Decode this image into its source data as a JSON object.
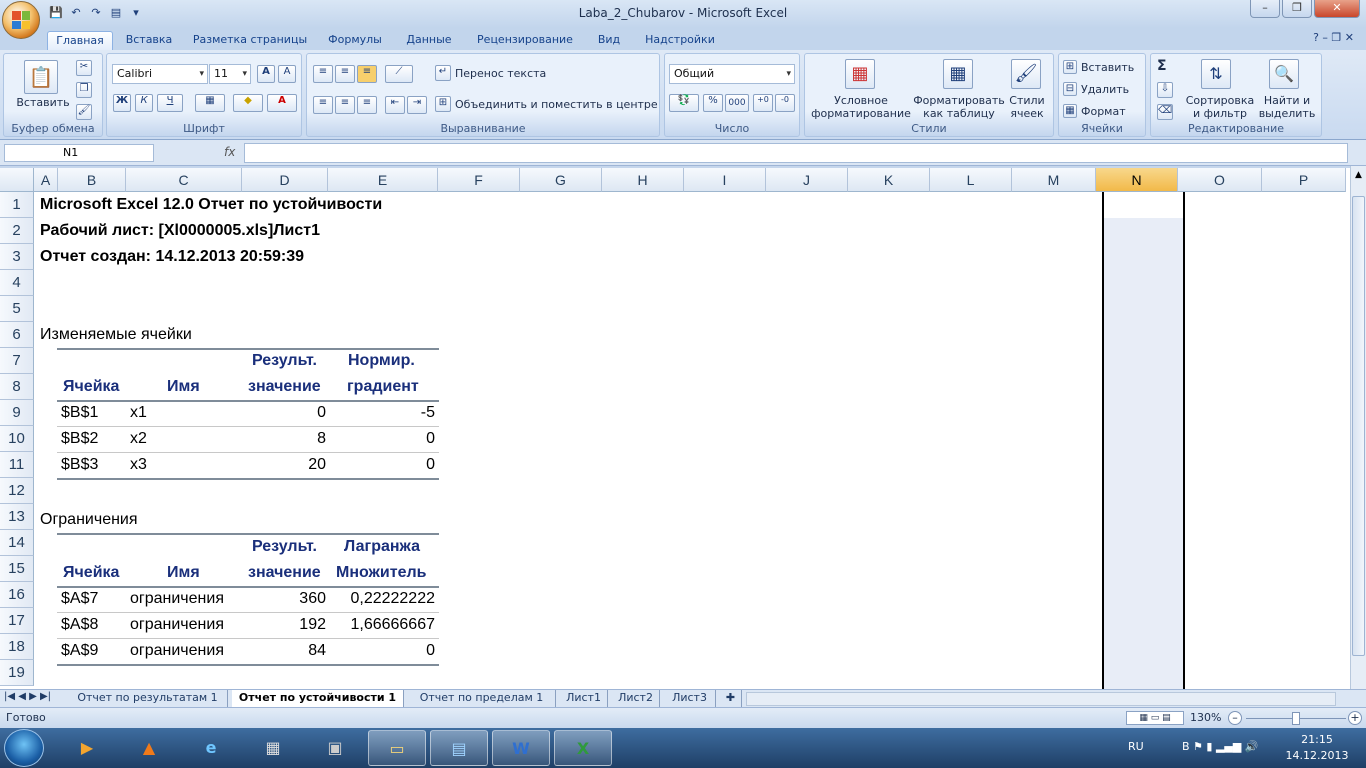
{
  "window": {
    "title": "Laba_2_Chubarov - Microsoft Excel",
    "min": "–",
    "max": "❐",
    "close": "✕"
  },
  "ribbon_tabs": [
    "Главная",
    "Вставка",
    "Разметка страницы",
    "Формулы",
    "Данные",
    "Рецензирование",
    "Вид",
    "Надстройки"
  ],
  "ribbon": {
    "clipboard": {
      "label": "Буфер обмена",
      "paste": "Вставить"
    },
    "font": {
      "label": "Шрифт",
      "name": "Calibri",
      "size": "11",
      "bold": "Ж",
      "italic": "К",
      "underline": "Ч"
    },
    "alignment": {
      "label": "Выравнивание",
      "wrap": "Перенос текста",
      "merge": "Объединить и поместить в центре"
    },
    "number": {
      "label": "Число",
      "format": "Общий",
      "percent": "%",
      "thousands": "000"
    },
    "styles": {
      "label": "Стили",
      "conditional": "Условное форматирование",
      "as_table": "Форматировать как таблицу",
      "cell_styles": "Стили ячеек"
    },
    "cells": {
      "label": "Ячейки",
      "insert": "Вставить",
      "delete": "Удалить",
      "format": "Формат"
    },
    "editing": {
      "label": "Редактирование",
      "sum": "Σ",
      "sort": "Сортировка и фильтр",
      "find": "Найти и выделить"
    }
  },
  "formula_bar": {
    "name_box": "N1",
    "fx": "fx",
    "value": ""
  },
  "columns": [
    "A",
    "B",
    "C",
    "D",
    "E",
    "F",
    "G",
    "H",
    "I",
    "J",
    "K",
    "L",
    "M",
    "N",
    "O",
    "P"
  ],
  "selected_column": "N",
  "rows": [
    "1",
    "2",
    "3",
    "4",
    "5",
    "6",
    "7",
    "8",
    "9",
    "10",
    "11",
    "12",
    "13",
    "14",
    "15",
    "16",
    "17",
    "18",
    "19"
  ],
  "report": {
    "title": "Microsoft Excel 12.0 Отчет по устойчивости",
    "sheet": "Рабочий лист: [Xl0000005.xls]Лист1",
    "created": "Отчет создан: 14.12.2013 20:59:39",
    "changing_label": "Изменяемые ячейки",
    "changing_headers": {
      "cell": "Ячейка",
      "name": "Имя",
      "value_1": "Результ.",
      "value_2": "значение",
      "grad_1": "Нормир.",
      "grad_2": "градиент"
    },
    "changing_rows": [
      {
        "cell": "$B$1",
        "name": "x1",
        "value": "0",
        "extra": "-5"
      },
      {
        "cell": "$B$2",
        "name": "x2",
        "value": "8",
        "extra": "0"
      },
      {
        "cell": "$B$3",
        "name": "x3",
        "value": "20",
        "extra": "0"
      }
    ],
    "constraints_label": "Ограничения",
    "constraints_headers": {
      "cell": "Ячейка",
      "name": "Имя",
      "value_1": "Результ.",
      "value_2": "значение",
      "lag_1": "Лагранжа",
      "lag_2": "Множитель"
    },
    "constraints_rows": [
      {
        "cell": "$A$7",
        "name": "ограничения",
        "value": "360",
        "extra": "0,22222222"
      },
      {
        "cell": "$A$8",
        "name": "ограничения",
        "value": "192",
        "extra": "1,66666667"
      },
      {
        "cell": "$A$9",
        "name": "ограничения",
        "value": "84",
        "extra": "0"
      }
    ]
  },
  "sheet_tabs": [
    "Отчет по результатам 1",
    "Отчет по устойчивости 1",
    "Отчет по пределам 1",
    "Лист1",
    "Лист2",
    "Лист3"
  ],
  "active_sheet": "Отчет по устойчивости 1",
  "status": {
    "ready": "Готово",
    "zoom": "130%"
  },
  "taskbar": {
    "lang": "RU",
    "time": "21:15",
    "date": "14.12.2013"
  }
}
